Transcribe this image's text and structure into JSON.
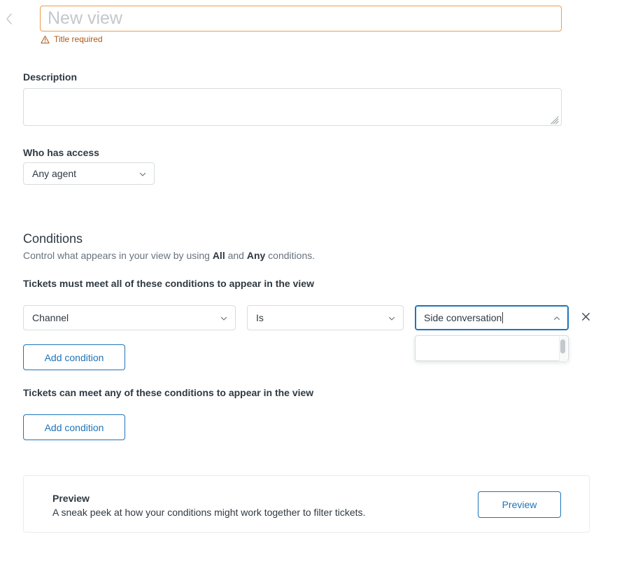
{
  "header": {
    "back_icon": "chevron-left-icon",
    "title_value": "",
    "title_placeholder": "New view",
    "error_icon": "warning-triangle-icon",
    "error_text": "Title required"
  },
  "description": {
    "label": "Description",
    "value": "",
    "placeholder": ""
  },
  "access": {
    "label": "Who has access",
    "selected": "Any agent",
    "caret_icon": "chevron-down-icon"
  },
  "conditions": {
    "title": "Conditions",
    "subtitle_prefix": "Control what appears in your view by using ",
    "subtitle_all": "All",
    "subtitle_mid": " and ",
    "subtitle_any": "Any",
    "subtitle_suffix": " conditions.",
    "all_heading": "Tickets must meet all of these conditions to appear in the view",
    "any_heading": "Tickets can meet any of these conditions to appear in the view",
    "row": {
      "field": "Channel",
      "operator": "Is",
      "value": "Side conversation",
      "field_caret_icon": "chevron-down-icon",
      "operator_caret_icon": "chevron-down-icon",
      "value_caret_icon": "chevron-up-icon",
      "remove_icon": "close-x-icon"
    },
    "dropdown": {
      "options": [],
      "scrollbar_icon": "scrollbar-thumb"
    },
    "add_condition_all_label": "Add condition",
    "add_condition_any_label": "Add condition"
  },
  "preview": {
    "title": "Preview",
    "subtitle": "A sneak peek at how your conditions might work together to filter tickets.",
    "button_label": "Preview"
  },
  "colors": {
    "accent_blue": "#1f73b7",
    "warning_orange": "#ed9b4e",
    "warning_text": "#ad5918",
    "border_gray": "#d8dcde",
    "text_primary": "#2f3941",
    "text_secondary": "#68737d"
  }
}
